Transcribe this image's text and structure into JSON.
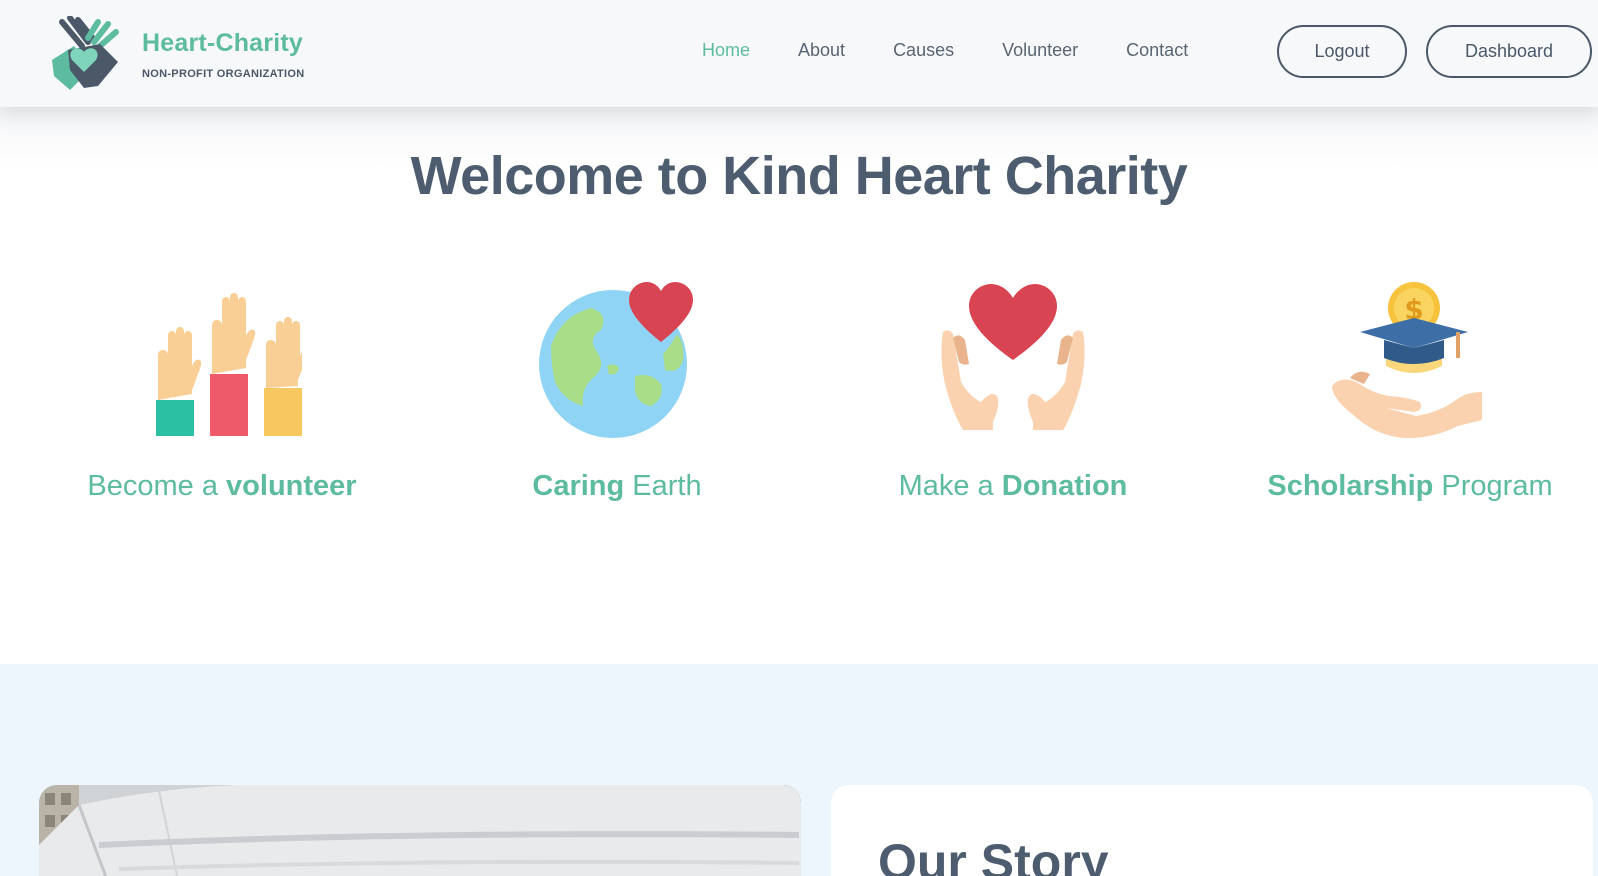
{
  "brand": {
    "name": "Heart-Charity",
    "tagline": "NON-PROFIT ORGANIZATION"
  },
  "nav": {
    "items": [
      {
        "label": "Home",
        "active": true
      },
      {
        "label": "About",
        "active": false
      },
      {
        "label": "Causes",
        "active": false
      },
      {
        "label": "Volunteer",
        "active": false
      },
      {
        "label": "Contact",
        "active": false
      }
    ],
    "logout_label": "Logout",
    "dashboard_label": "Dashboard"
  },
  "welcome": {
    "title": "Welcome to Kind Heart Charity"
  },
  "features": [
    {
      "icon": "raised-hands-icon",
      "prefix": "Become a ",
      "bold": "volunteer",
      "suffix": ""
    },
    {
      "icon": "earth-heart-icon",
      "prefix": "",
      "bold": "Caring",
      "suffix": " Earth"
    },
    {
      "icon": "hands-heart-icon",
      "prefix": "Make a ",
      "bold": "Donation",
      "suffix": ""
    },
    {
      "icon": "scholarship-icon",
      "prefix": "",
      "bold": "Scholarship",
      "suffix": " Program"
    }
  ],
  "story": {
    "title": "Our Story"
  },
  "colors": {
    "accent": "#5dbba0",
    "heading": "#4d5d6f",
    "header_bg": "#f7f8fa",
    "lower_bg": "#eef6fd"
  }
}
